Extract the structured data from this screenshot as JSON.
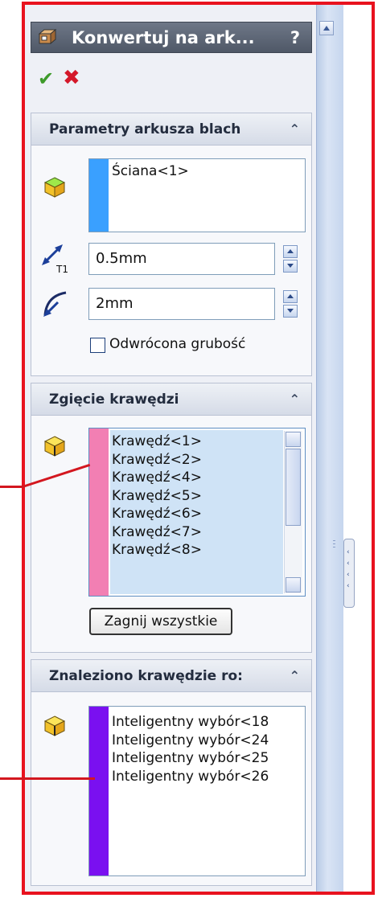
{
  "window": {
    "title": "Konwertuj na ark...",
    "help_label": "?"
  },
  "actions": {
    "ok_glyph": "✔",
    "cancel_glyph": "✖"
  },
  "sheet_params": {
    "title": "Parametry arkusza blach",
    "face_items": [
      "Ściana<1>"
    ],
    "thickness": "0.5mm",
    "radius": "2mm",
    "reverse_label": "Odwrócona grubość",
    "reverse_checked": false
  },
  "edge_bend": {
    "title": "Zgięcie krawędzi",
    "items": [
      "Krawędź<1>",
      "Krawędź<2>",
      "Krawędź<4>",
      "Krawędź<5>",
      "Krawędź<6>",
      "Krawędź<7>",
      "Krawędź<8>"
    ],
    "button_label": "Zagnij wszystkie"
  },
  "found_edges": {
    "title": "Znaleziono krawędzie ro:",
    "items": [
      "Inteligentny wybór<18",
      "Inteligentny wybór<24",
      "Inteligentny wybór<25",
      "Inteligentny wybór<26"
    ]
  },
  "colors": {
    "highlight": "#e8121e",
    "face_bar": "#3aa0ff",
    "edge_bar": "#f27fb3",
    "found_bar": "#7a10f0",
    "selected_bg": "#cfe3f6"
  }
}
